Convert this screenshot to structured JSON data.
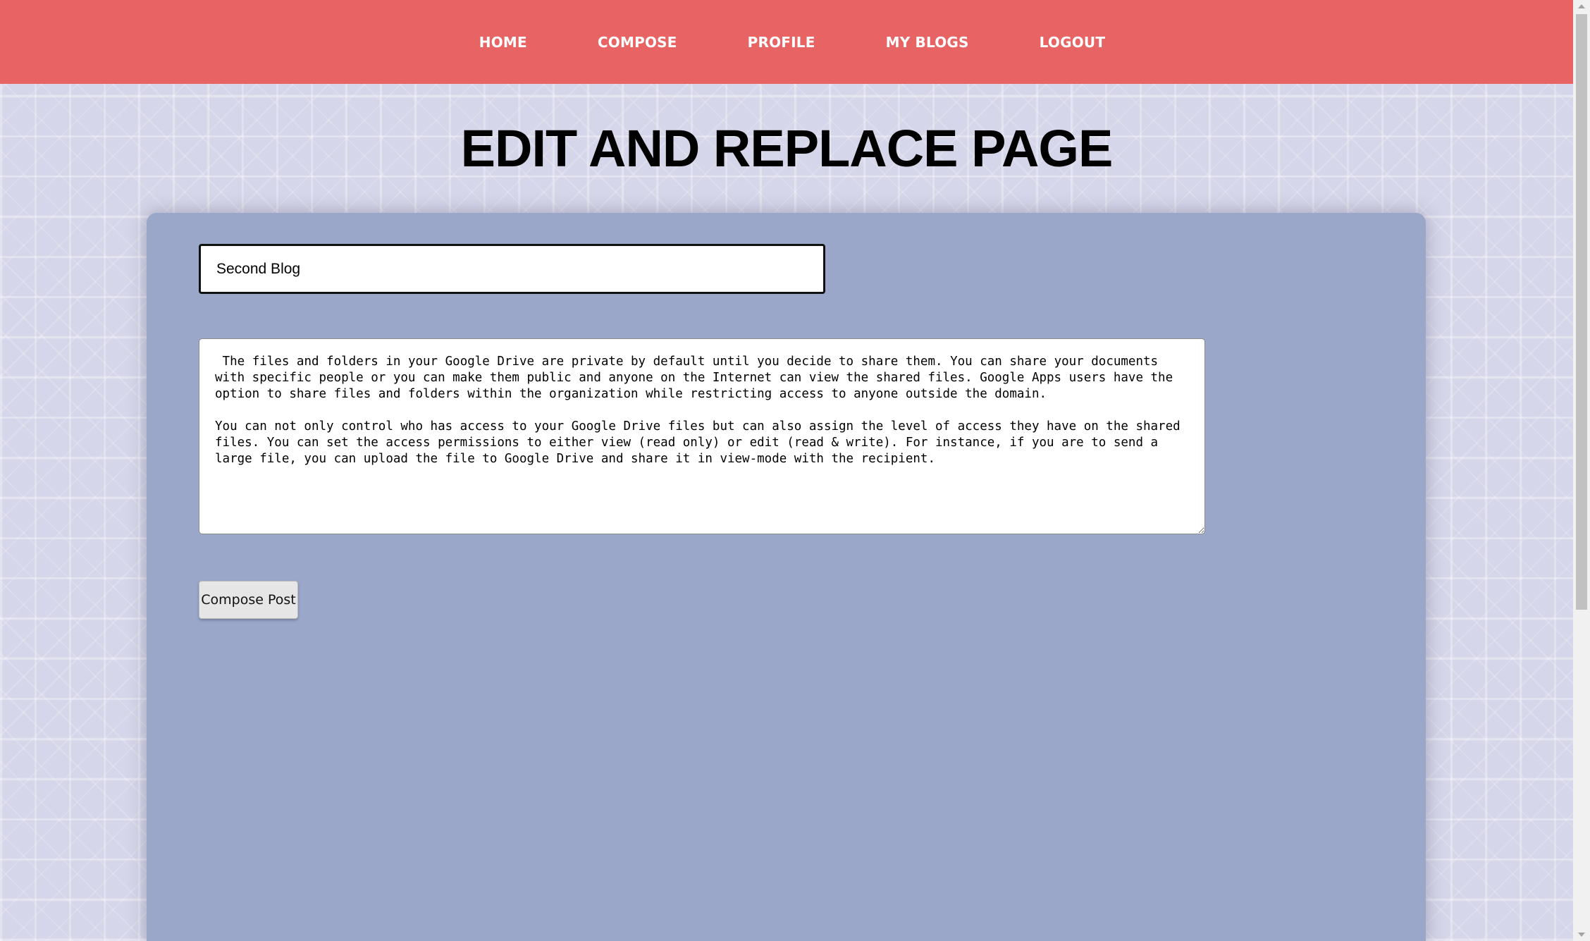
{
  "nav": {
    "items": [
      {
        "label": "HOME"
      },
      {
        "label": "COMPOSE"
      },
      {
        "label": "PROFILE"
      },
      {
        "label": "MY BLOGS"
      },
      {
        "label": "LOGOUT"
      }
    ]
  },
  "page": {
    "title": "EDIT AND REPLACE PAGE"
  },
  "form": {
    "title_value": "Second Blog",
    "content_value": " The files and folders in your Google Drive are private by default until you decide to share them. You can share your documents with specific people or you can make them public and anyone on the Internet can view the shared files. Google Apps users have the option to share files and folders within the organization while restricting access to anyone outside the domain.\n\nYou can not only control who has access to your Google Drive files but can also assign the level of access they have on the shared files. You can set the access permissions to either view (read only) or edit (read & write). For instance, if you are to send a large file, you can upload the file to Google Drive and share it in view-mode with the recipient.",
    "submit_label": "Compose Post"
  },
  "colors": {
    "navbar": "#e86464",
    "card": "#9aa7c9",
    "background": "#d6d6ea"
  }
}
